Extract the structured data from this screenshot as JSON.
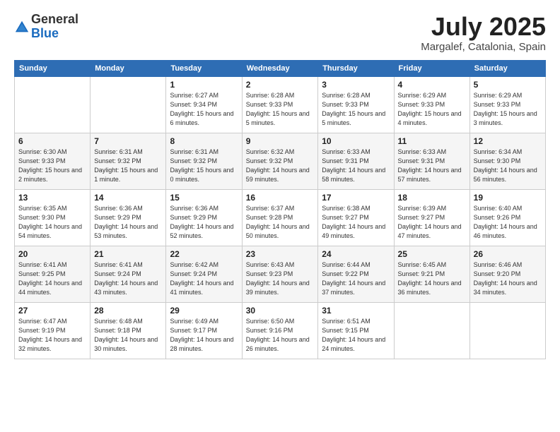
{
  "logo": {
    "general": "General",
    "blue": "Blue"
  },
  "title": {
    "month_year": "July 2025",
    "location": "Margalef, Catalonia, Spain"
  },
  "weekdays": [
    "Sunday",
    "Monday",
    "Tuesday",
    "Wednesday",
    "Thursday",
    "Friday",
    "Saturday"
  ],
  "weeks": [
    [
      {
        "day": "",
        "info": ""
      },
      {
        "day": "",
        "info": ""
      },
      {
        "day": "1",
        "info": "Sunrise: 6:27 AM\nSunset: 9:34 PM\nDaylight: 15 hours and 6 minutes."
      },
      {
        "day": "2",
        "info": "Sunrise: 6:28 AM\nSunset: 9:33 PM\nDaylight: 15 hours and 5 minutes."
      },
      {
        "day": "3",
        "info": "Sunrise: 6:28 AM\nSunset: 9:33 PM\nDaylight: 15 hours and 5 minutes."
      },
      {
        "day": "4",
        "info": "Sunrise: 6:29 AM\nSunset: 9:33 PM\nDaylight: 15 hours and 4 minutes."
      },
      {
        "day": "5",
        "info": "Sunrise: 6:29 AM\nSunset: 9:33 PM\nDaylight: 15 hours and 3 minutes."
      }
    ],
    [
      {
        "day": "6",
        "info": "Sunrise: 6:30 AM\nSunset: 9:33 PM\nDaylight: 15 hours and 2 minutes."
      },
      {
        "day": "7",
        "info": "Sunrise: 6:31 AM\nSunset: 9:32 PM\nDaylight: 15 hours and 1 minute."
      },
      {
        "day": "8",
        "info": "Sunrise: 6:31 AM\nSunset: 9:32 PM\nDaylight: 15 hours and 0 minutes."
      },
      {
        "day": "9",
        "info": "Sunrise: 6:32 AM\nSunset: 9:32 PM\nDaylight: 14 hours and 59 minutes."
      },
      {
        "day": "10",
        "info": "Sunrise: 6:33 AM\nSunset: 9:31 PM\nDaylight: 14 hours and 58 minutes."
      },
      {
        "day": "11",
        "info": "Sunrise: 6:33 AM\nSunset: 9:31 PM\nDaylight: 14 hours and 57 minutes."
      },
      {
        "day": "12",
        "info": "Sunrise: 6:34 AM\nSunset: 9:30 PM\nDaylight: 14 hours and 56 minutes."
      }
    ],
    [
      {
        "day": "13",
        "info": "Sunrise: 6:35 AM\nSunset: 9:30 PM\nDaylight: 14 hours and 54 minutes."
      },
      {
        "day": "14",
        "info": "Sunrise: 6:36 AM\nSunset: 9:29 PM\nDaylight: 14 hours and 53 minutes."
      },
      {
        "day": "15",
        "info": "Sunrise: 6:36 AM\nSunset: 9:29 PM\nDaylight: 14 hours and 52 minutes."
      },
      {
        "day": "16",
        "info": "Sunrise: 6:37 AM\nSunset: 9:28 PM\nDaylight: 14 hours and 50 minutes."
      },
      {
        "day": "17",
        "info": "Sunrise: 6:38 AM\nSunset: 9:27 PM\nDaylight: 14 hours and 49 minutes."
      },
      {
        "day": "18",
        "info": "Sunrise: 6:39 AM\nSunset: 9:27 PM\nDaylight: 14 hours and 47 minutes."
      },
      {
        "day": "19",
        "info": "Sunrise: 6:40 AM\nSunset: 9:26 PM\nDaylight: 14 hours and 46 minutes."
      }
    ],
    [
      {
        "day": "20",
        "info": "Sunrise: 6:41 AM\nSunset: 9:25 PM\nDaylight: 14 hours and 44 minutes."
      },
      {
        "day": "21",
        "info": "Sunrise: 6:41 AM\nSunset: 9:24 PM\nDaylight: 14 hours and 43 minutes."
      },
      {
        "day": "22",
        "info": "Sunrise: 6:42 AM\nSunset: 9:24 PM\nDaylight: 14 hours and 41 minutes."
      },
      {
        "day": "23",
        "info": "Sunrise: 6:43 AM\nSunset: 9:23 PM\nDaylight: 14 hours and 39 minutes."
      },
      {
        "day": "24",
        "info": "Sunrise: 6:44 AM\nSunset: 9:22 PM\nDaylight: 14 hours and 37 minutes."
      },
      {
        "day": "25",
        "info": "Sunrise: 6:45 AM\nSunset: 9:21 PM\nDaylight: 14 hours and 36 minutes."
      },
      {
        "day": "26",
        "info": "Sunrise: 6:46 AM\nSunset: 9:20 PM\nDaylight: 14 hours and 34 minutes."
      }
    ],
    [
      {
        "day": "27",
        "info": "Sunrise: 6:47 AM\nSunset: 9:19 PM\nDaylight: 14 hours and 32 minutes."
      },
      {
        "day": "28",
        "info": "Sunrise: 6:48 AM\nSunset: 9:18 PM\nDaylight: 14 hours and 30 minutes."
      },
      {
        "day": "29",
        "info": "Sunrise: 6:49 AM\nSunset: 9:17 PM\nDaylight: 14 hours and 28 minutes."
      },
      {
        "day": "30",
        "info": "Sunrise: 6:50 AM\nSunset: 9:16 PM\nDaylight: 14 hours and 26 minutes."
      },
      {
        "day": "31",
        "info": "Sunrise: 6:51 AM\nSunset: 9:15 PM\nDaylight: 14 hours and 24 minutes."
      },
      {
        "day": "",
        "info": ""
      },
      {
        "day": "",
        "info": ""
      }
    ]
  ]
}
